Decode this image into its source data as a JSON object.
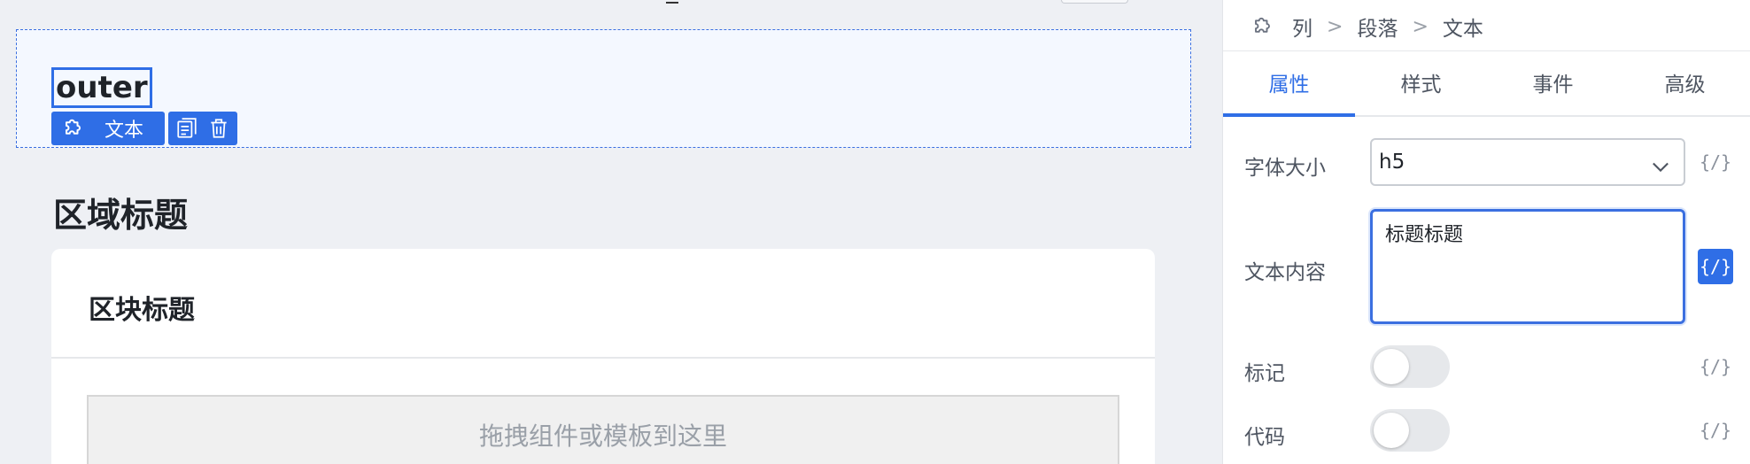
{
  "canvas": {
    "selected_text": "outer",
    "toolbar_label": "文本",
    "region_title": "区域标题",
    "block_title": "区块标题",
    "drop_zone_text": "拖拽组件或模板到这里"
  },
  "panel": {
    "breadcrumb": [
      "列",
      "段落",
      "文本"
    ],
    "tabs": [
      "属性",
      "样式",
      "事件",
      "高级"
    ],
    "active_tab": "属性",
    "fields": {
      "font_size": {
        "label": "字体大小",
        "value": "h5"
      },
      "text_content": {
        "label": "文本内容",
        "value": "标题标题"
      },
      "mark": {
        "label": "标记",
        "checked": false
      },
      "code": {
        "label": "代码",
        "checked": false
      }
    },
    "code_toggle_text": "{/}"
  },
  "colors": {
    "accent": "#2f6ee6",
    "canvas_bg": "#eef0f4"
  }
}
